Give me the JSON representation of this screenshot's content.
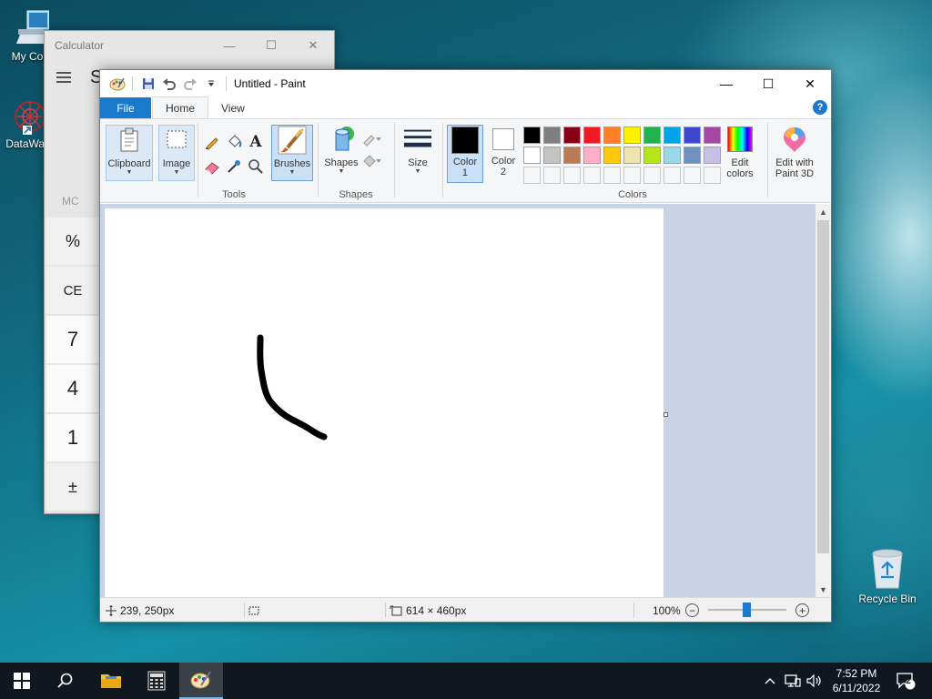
{
  "desktop": {
    "icons": [
      {
        "label": "My Com"
      },
      {
        "label": "DataWag"
      },
      {
        "label": "Recycle Bin"
      }
    ]
  },
  "calculator": {
    "title": "Calculator",
    "menu_glyph": "≡",
    "mode_initial": "S",
    "memory_label": "MC",
    "keys": [
      "%",
      "CE",
      "7",
      "4",
      "1",
      "±"
    ]
  },
  "paint": {
    "title": "Untitled - Paint",
    "tabs": [
      "File",
      "Home",
      "View"
    ],
    "active_tab": "Home",
    "groups": {
      "clipboard": "Clipboard",
      "image": "Image",
      "tools": "Tools",
      "brushes": "Brushes",
      "shapes": "Shapes",
      "shapes_group": "Shapes",
      "size": "Size",
      "color1": "Color\n1",
      "color2": "Color\n2",
      "colors_group": "Colors",
      "edit_colors": "Edit\ncolors",
      "edit_paint3d": "Edit with\nPaint 3D"
    },
    "color1_label_a": "Color",
    "color1_label_b": "1",
    "color2_label_a": "Color",
    "color2_label_b": "2",
    "edit_colors_a": "Edit",
    "edit_colors_b": "colors",
    "paint3d_a": "Edit with",
    "paint3d_b": "Paint 3D",
    "palette_row1": [
      "#000000",
      "#7f7f7f",
      "#880015",
      "#ed1c24",
      "#ff7f27",
      "#fff200",
      "#22b14c",
      "#00a2e8",
      "#3f48cc",
      "#a349a4"
    ],
    "palette_row2": [
      "#ffffff",
      "#c3c3c3",
      "#b97a57",
      "#ffaec9",
      "#ffc90e",
      "#efe4b0",
      "#b5e61d",
      "#99d9ea",
      "#7092be",
      "#c8bfe7"
    ],
    "color1": "#000000",
    "color2": "#ffffff",
    "status": {
      "cursor_pos": "239, 250px",
      "canvas_size": "614 × 460px",
      "zoom": "100%"
    }
  },
  "taskbar": {
    "time": "7:52 PM",
    "date": "6/11/2022",
    "notification_count": "2"
  }
}
